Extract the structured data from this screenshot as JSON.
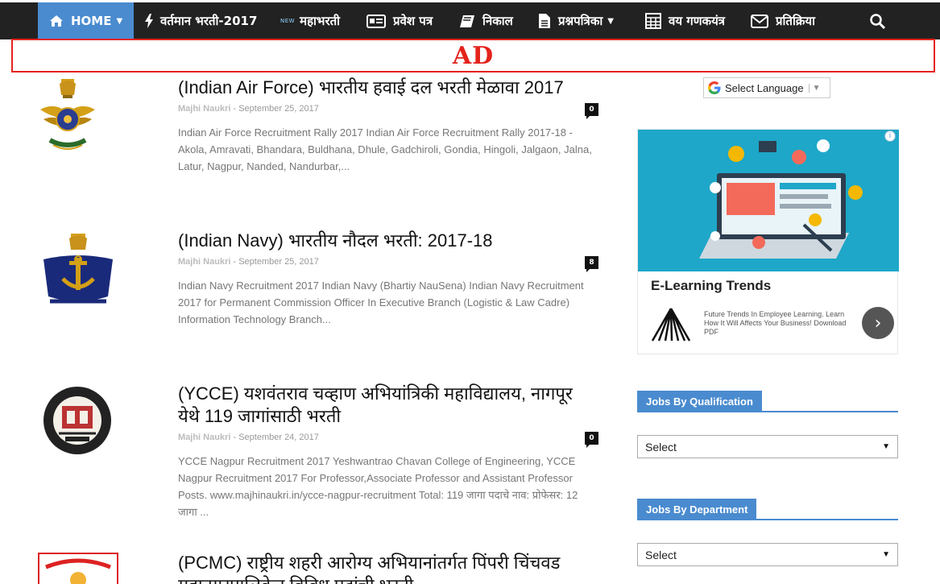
{
  "nav": {
    "home": "HOME",
    "items": [
      {
        "label": "वर्तमान भरती-2017",
        "icon": "bolt-icon"
      },
      {
        "label": "महाभरती",
        "icon": "new-tag-icon",
        "tag": "NEW"
      },
      {
        "label": "प्रवेश पत्र",
        "icon": "id-card-icon"
      },
      {
        "label": "निकाल",
        "icon": "book-icon"
      },
      {
        "label": "प्रश्नपत्रिका",
        "icon": "document-icon"
      },
      {
        "label": "वय गणकयंत्र",
        "icon": "calculator-icon"
      },
      {
        "label": "प्रतिक्रिया",
        "icon": "envelope-icon"
      }
    ],
    "search_icon": "search-icon"
  },
  "ad_banner": "AD",
  "posts": [
    {
      "title": "(Indian Air Force) भारतीय हवाई दल भरती मेळावा 2017",
      "author": "Majhi Naukri",
      "date": "September 25, 2017",
      "comments": "0",
      "excerpt": "Indian Air Force Recruitment Rally 2017 Indian Air Force Recruitment Rally 2017-18 - Akola, Amravati, Bhandara, Buldhana, Dhule, Gadchiroli, Gondia, Hingoli, Jalgaon, Jalna, Latur, Nagpur, Nanded, Nandurbar,..."
    },
    {
      "title": "(Indian Navy) भारतीय नौदल भरती: 2017-18",
      "author": "Majhi Naukri",
      "date": "September 25, 2017",
      "comments": "8",
      "excerpt": "Indian Navy Recruitment 2017 Indian Navy (Bhartiy NauSena) Indian Navy Recruitment 2017  for  Permanent Commission Officer In Executive Branch (Logistic & Law Cadre) Information Technology Branch..."
    },
    {
      "title": "(YCCE) यशवंतराव चव्हाण अभियांत्रिकी महाविद्यालय, नागपूर येथे 119 जागांसाठी भरती",
      "author": "Majhi Naukri",
      "date": "September 24, 2017",
      "comments": "0",
      "excerpt": "YCCE Nagpur Recruitment 2017 Yeshwantrao Chavan College of Engineering, YCCE Nagpur Recruitment 2017 For Professor,Associate Professor and Assistant Professor Posts.   www.majhinaukri.in/ycce-nagpur-recruitment Total: 119 जागा पदाचे नाव: प्रोफेसर: 12 जागा ..."
    },
    {
      "title": "(PCMC) राष्ट्रीय शहरी आरोग्य अभियानांतर्गत पिंपरी चिंचवड महानगरपालिकेत विविध पदांची भरती"
    }
  ],
  "sidebar": {
    "language": "Select Language",
    "ad": {
      "heading": "E-Learning Trends",
      "description": "Future Trends In Employee Learning. Learn How It Will Affects Your Business! Download PDF",
      "info": "i"
    },
    "widgets": [
      {
        "title": "Jobs By Qualification",
        "select": "Select"
      },
      {
        "title": "Jobs By Department",
        "select": "Select"
      }
    ]
  }
}
